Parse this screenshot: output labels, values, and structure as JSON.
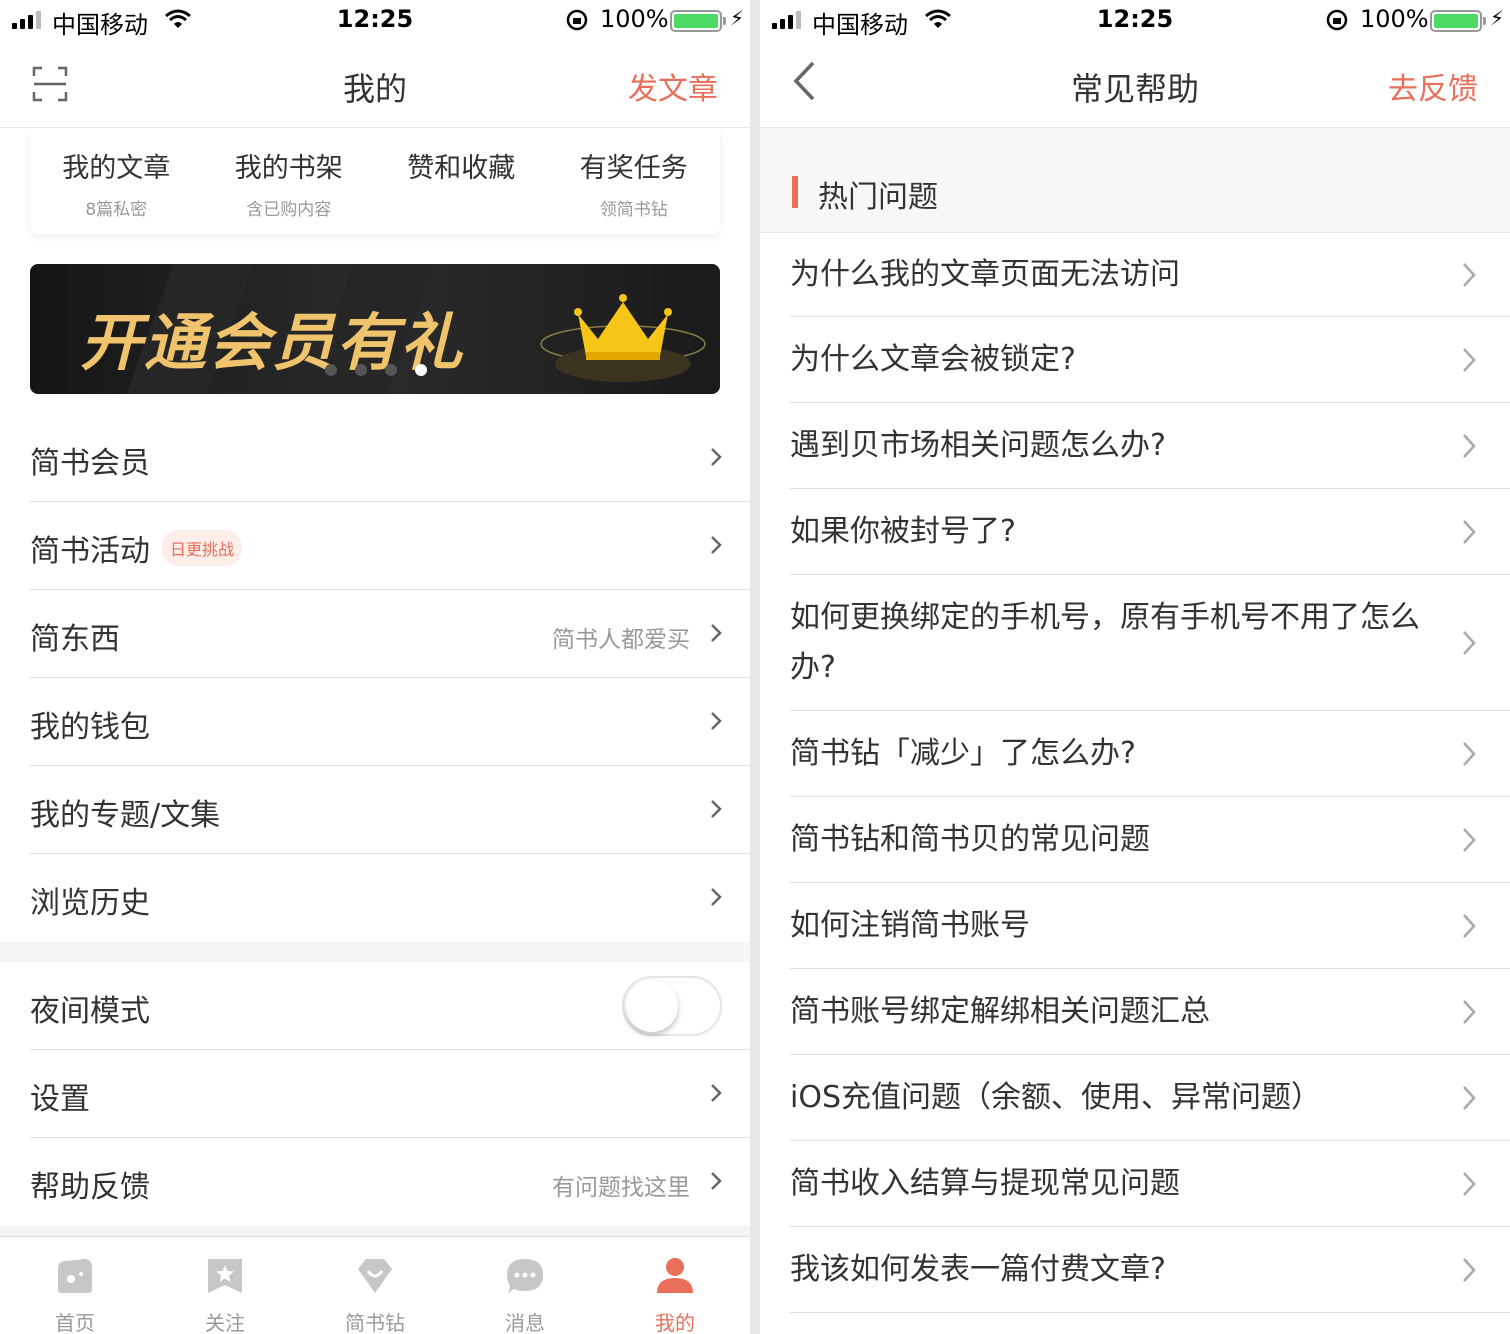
{
  "status_bar": {
    "carrier": "中国移动",
    "time": "12:25",
    "battery_pct": "100%"
  },
  "left": {
    "nav": {
      "title": "我的",
      "action": "发文章"
    },
    "stats": [
      {
        "title": "我的文章",
        "sub": "8篇私密"
      },
      {
        "title": "我的书架",
        "sub": "含已购内容"
      },
      {
        "title": "赞和收藏",
        "sub": ""
      },
      {
        "title": "有奖任务",
        "sub": "领简书钻"
      }
    ],
    "banner": {
      "text": "开通会员有礼",
      "slides": 4,
      "active_slide": 4
    },
    "menu": [
      {
        "label": "简书会员",
        "sub": ""
      },
      {
        "label": "简书活动",
        "badge": "日更挑战"
      },
      {
        "label": "简东西",
        "sub": "简书人都爱买"
      },
      {
        "label": "我的钱包",
        "sub": ""
      },
      {
        "label": "我的专题/文集",
        "sub": ""
      },
      {
        "label": "浏览历史",
        "sub": ""
      }
    ],
    "menu2": [
      {
        "label": "夜间模式",
        "toggle": false
      },
      {
        "label": "设置",
        "sub": ""
      },
      {
        "label": "帮助反馈",
        "sub": "有问题找这里"
      }
    ],
    "tabs": [
      {
        "label": "首页",
        "icon": "home-icon"
      },
      {
        "label": "关注",
        "icon": "follow-icon"
      },
      {
        "label": "简书钻",
        "icon": "diamond-icon"
      },
      {
        "label": "消息",
        "icon": "message-icon"
      },
      {
        "label": "我的",
        "icon": "profile-icon",
        "active": true
      }
    ]
  },
  "right": {
    "nav": {
      "title": "常见帮助",
      "action": "去反馈"
    },
    "section": "热门问题",
    "faqs": [
      "为什么我的文章页面无法访问",
      "为什么文章会被锁定?",
      "遇到贝市场相关问题怎么办?",
      "如果你被封号了?",
      "如何更换绑定的手机号，原有手机号不用了怎么办?",
      "简书钻「减少」了怎么办?",
      "简书钻和简书贝的常见问题",
      "如何注销简书账号",
      "简书账号绑定解绑相关问题汇总",
      "iOS充值问题（余额、使用、异常问题）",
      "简书收入结算与提现常见问题",
      "我该如何发表一篇付费文章?"
    ]
  },
  "colors": {
    "accent": "#ea6f5a",
    "text": "#333333",
    "muted": "#999999",
    "battery": "#4cd964"
  }
}
